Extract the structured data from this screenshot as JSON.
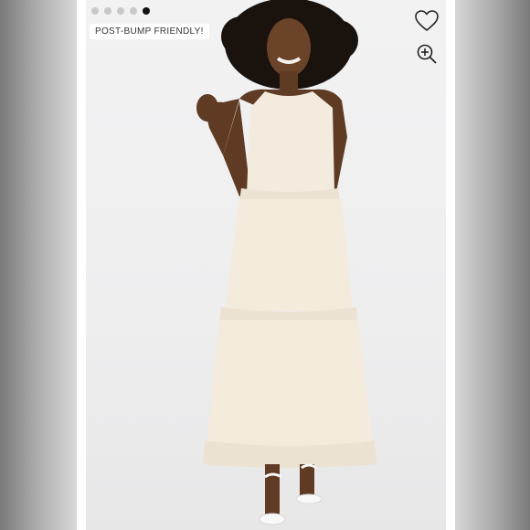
{
  "carousel": {
    "dot_count": 5,
    "active_index": 4
  },
  "badge": {
    "label": "POST-BUMP FRIENDLY!"
  },
  "actions": {
    "like_icon": "heart-outline-icon",
    "zoom_icon": "zoom-in-icon"
  },
  "colors": {
    "background": "#efefef",
    "dress": "#f3ebdc",
    "accent": "#111111"
  }
}
